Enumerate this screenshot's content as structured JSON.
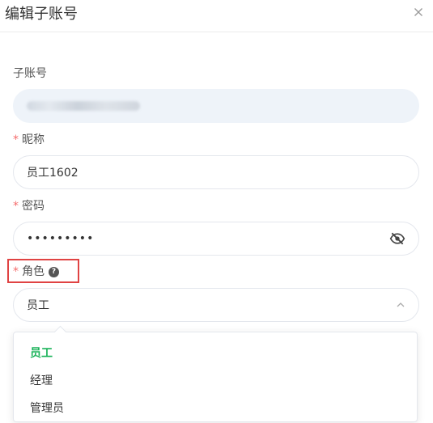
{
  "dialog": {
    "title": "编辑子账号"
  },
  "form": {
    "account": {
      "label": "子账号"
    },
    "nickname": {
      "label": "昵称",
      "required_mark": "*",
      "value": "员工1602"
    },
    "password": {
      "label": "密码",
      "required_mark": "*",
      "value": "•••••••••"
    },
    "role": {
      "label": "角色",
      "required_mark": "*",
      "help_glyph": "?",
      "value": "员工"
    }
  },
  "dropdown": {
    "options": [
      "员工",
      "经理",
      "管理员"
    ],
    "selected": "员工"
  },
  "colors": {
    "required": "#f56c6c",
    "selected_option": "#1bb35a",
    "highlight_box": "#e04343",
    "disabled_bg": "#eef3f9"
  },
  "icons": {
    "close": "close-icon",
    "password_toggle": "eye-off-icon",
    "help": "question-circle-icon",
    "chevron": "chevron-up-icon"
  }
}
